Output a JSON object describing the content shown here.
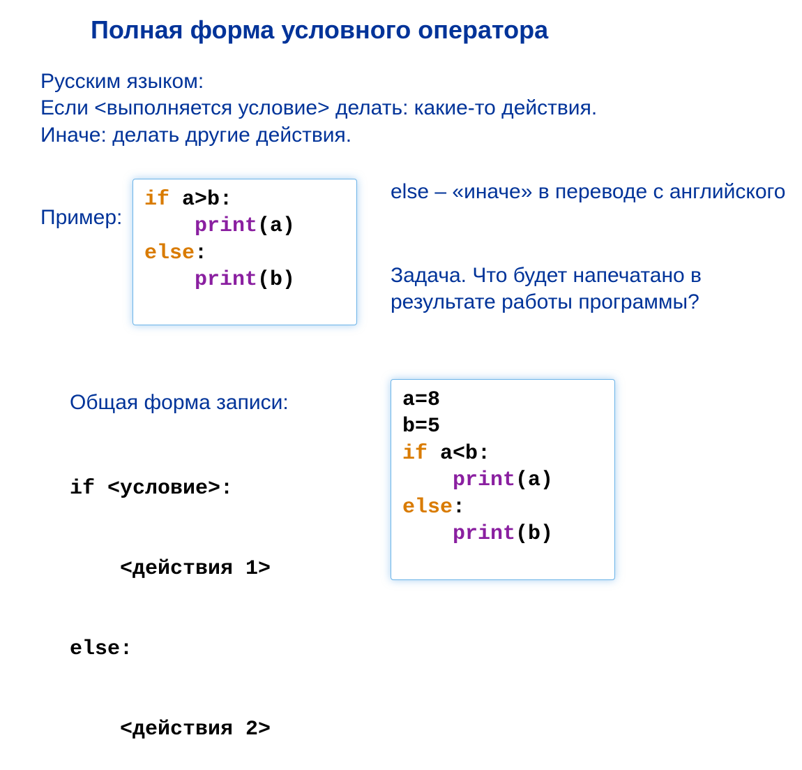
{
  "title": "Полная форма условного оператора",
  "rus_intro": "Русским языком:\nЕсли <выполняется условие> делать: какие-то действия.\nИначе: делать другие действия.",
  "example_label": "Пример:",
  "else_note": "else – «иначе» в переводе с английского",
  "task_text": "Задача. Что будет напечатано в результате работы программы?",
  "form_label": "Общая форма записи:",
  "code1": {
    "l1_kw": "if",
    "l1_rest": " a>b:",
    "l2_indent": "    ",
    "l2_fn": "print",
    "l2_arg": "(a)",
    "l3_kw": "else",
    "l3_rest": ":",
    "l4_indent": "    ",
    "l4_fn": "print",
    "l4_arg": "(b)"
  },
  "general": {
    "l1": "if <условие>:",
    "l2": "    <действия 1>",
    "l3": "else:",
    "l4": "    <действия 2>"
  },
  "code2": {
    "l1": "a=8",
    "l2": "b=5",
    "l3_kw": "if",
    "l3_rest": " a<b:",
    "l4_indent": "    ",
    "l4_fn": "print",
    "l4_arg": "(a)",
    "l5_kw": "else",
    "l5_rest": ":",
    "l6_indent": "    ",
    "l6_fn": "print",
    "l6_arg": "(b)"
  }
}
